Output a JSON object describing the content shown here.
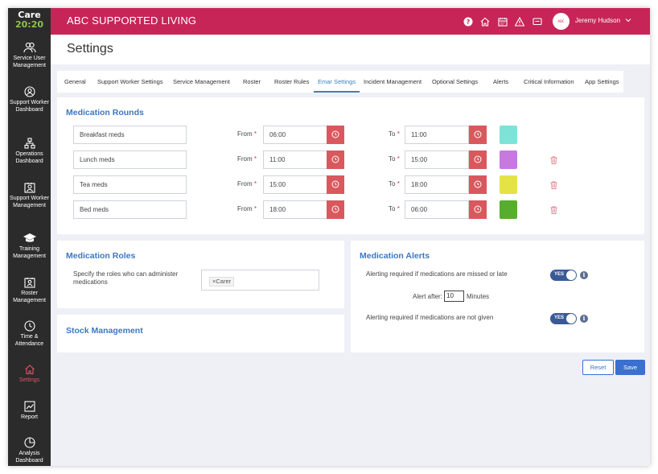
{
  "logo": {
    "line1": "Care",
    "line2": "20:20"
  },
  "sidebar": {
    "items": [
      {
        "label": "Service User Management"
      },
      {
        "label": "Support Worker Dashboard"
      },
      {
        "label": "Operations Dashboard"
      },
      {
        "label": "Support Worker Management"
      },
      {
        "label": "Training Management"
      },
      {
        "label": "Roster Management"
      },
      {
        "label": "Time & Attendance"
      },
      {
        "label": "Settings",
        "active": true
      },
      {
        "label": "Report"
      },
      {
        "label": "Analysis Dashboard"
      }
    ]
  },
  "header": {
    "app_title": "ABC SUPPORTED LIVING",
    "icons": [
      "help-icon",
      "home-icon",
      "calendar-icon",
      "warning-icon",
      "message-icon"
    ],
    "user_name": "Jeremy Hudson"
  },
  "page": {
    "title": "Settings"
  },
  "tabs": [
    {
      "label": "General"
    },
    {
      "label": "Support Worker Settings"
    },
    {
      "label": "Service Management"
    },
    {
      "label": "Roster"
    },
    {
      "label": "Roster Rules"
    },
    {
      "label": "Emar Settings",
      "active": true
    },
    {
      "label": "Incident Management"
    },
    {
      "label": "Optional Settings"
    },
    {
      "label": "Alerts"
    },
    {
      "label": "Critical Information"
    },
    {
      "label": "App Settings"
    }
  ],
  "medication_rounds": {
    "title": "Medication Rounds",
    "from_label": "From",
    "to_label": "To",
    "required_mark": "*",
    "rows": [
      {
        "name": "Breakfast meds",
        "from": "06:00",
        "to": "11:00",
        "color": "#7de3d9",
        "deletable": false
      },
      {
        "name": "Lunch meds",
        "from": "11:00",
        "to": "15:00",
        "color": "#c779e0",
        "deletable": true
      },
      {
        "name": "Tea meds",
        "from": "15:00",
        "to": "18:00",
        "color": "#e4e345",
        "deletable": true
      },
      {
        "name": "Bed meds",
        "from": "18:00",
        "to": "06:00",
        "color": "#56ad2e",
        "deletable": true
      }
    ]
  },
  "medication_roles": {
    "title": "Medication Roles",
    "label": "Specify the roles who can administer medications",
    "tag_remove": "×",
    "tag": "Carer"
  },
  "stock_management": {
    "title": "Stock Management"
  },
  "medication_alerts": {
    "title": "Medication Alerts",
    "missed_label": "Alerting required if medications are missed or late",
    "missed_toggle": "YES",
    "alert_after_label": "Alert after:",
    "alert_after_value": "10",
    "alert_after_unit": "Minutes",
    "not_given_label": "Alerting required if medications are not given",
    "not_given_toggle": "YES",
    "info_glyph": "i"
  },
  "actions": {
    "reset": "Reset",
    "save": "Save"
  },
  "colors": {
    "header": "#c72557",
    "sidebar": "#2b2b2b",
    "accent": "#3b6fd0",
    "section_title": "#3a78c3",
    "clock_button": "#d9585e"
  }
}
